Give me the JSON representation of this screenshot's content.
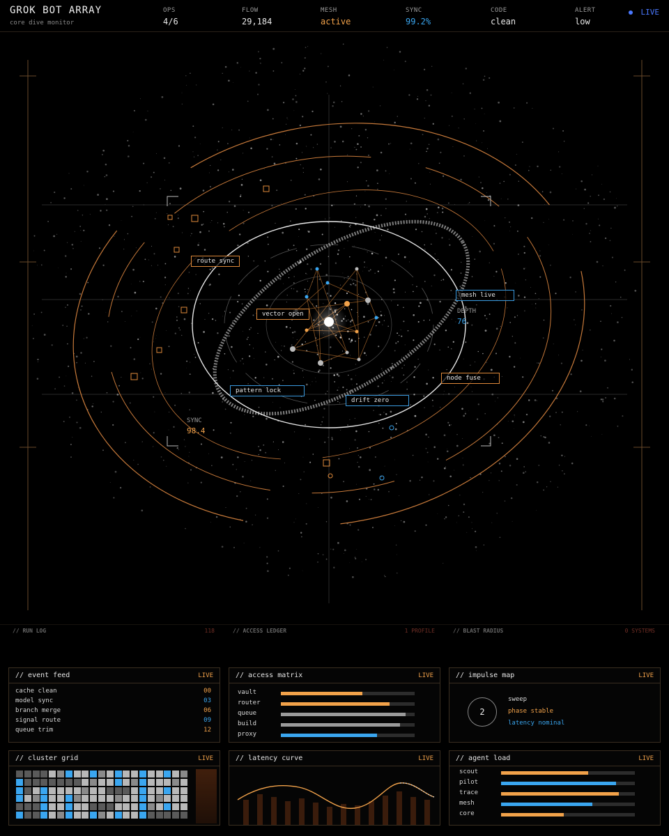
{
  "header": {
    "title": "GROK BOT ARRAY",
    "subtitle": "core dive monitor",
    "stats": [
      {
        "key": "OPS",
        "value": "4/6",
        "tone": "white"
      },
      {
        "key": "FLOW",
        "value": "29,184",
        "tone": "white"
      },
      {
        "key": "MESH",
        "value": "active",
        "tone": "orange"
      },
      {
        "key": "SYNC",
        "value": "99.2%",
        "tone": "blue"
      },
      {
        "key": "CODE",
        "value": "clean",
        "tone": "white"
      },
      {
        "key": "ALERT",
        "value": "low",
        "tone": "white"
      }
    ],
    "live": "LIVE"
  },
  "viz": {
    "tags": {
      "route_sync": "route sync",
      "vector_open": "vector open",
      "mesh_live": "mesh live",
      "node_fuse": "node fuse",
      "pattern_lock": "pattern lock",
      "drift_zero": "drift zero"
    },
    "depth": {
      "label": "DEPTH",
      "value": "76"
    },
    "sync": {
      "label": "SYNC",
      "value": "98.4"
    }
  },
  "ghost": {
    "run_log": {
      "title": "// RUN LOG",
      "count": "118"
    },
    "access_ledger": {
      "title": "// ACCESS LEDGER",
      "count": "1 PROFILE"
    },
    "blast_radius": {
      "title": "// BLAST RADIUS",
      "count": "0 SYSTEMS"
    }
  },
  "panels": {
    "event_feed": {
      "title": "// event feed",
      "live": "LIVE",
      "rows": [
        {
          "label": "cache clean",
          "value": "00",
          "tone": "o"
        },
        {
          "label": "model sync",
          "value": "03",
          "tone": "b"
        },
        {
          "label": "branch merge",
          "value": "06",
          "tone": "o"
        },
        {
          "label": "signal route",
          "value": "09",
          "tone": "b"
        },
        {
          "label": "queue trim",
          "value": "12",
          "tone": "o"
        }
      ]
    },
    "access_matrix": {
      "title": "// access matrix",
      "live": "LIVE",
      "rows": [
        {
          "label": "vault",
          "level": 0.61,
          "color": "#f2a24a"
        },
        {
          "label": "router",
          "level": 0.81,
          "color": "#f2a24a"
        },
        {
          "label": "queue",
          "level": 0.93,
          "color": "#9a9a9a"
        },
        {
          "label": "build",
          "level": 0.89,
          "color": "#9a9a9a"
        },
        {
          "label": "proxy",
          "level": 0.72,
          "color": "#3aa6f0"
        }
      ]
    },
    "impulse_map": {
      "title": "// impulse map",
      "live": "LIVE",
      "count": "2",
      "lines": [
        {
          "text": "sweep",
          "color": "#d8d8d8"
        },
        {
          "text": "phase stable",
          "color": "#f2a24a"
        },
        {
          "text": "latency nominal",
          "color": "#3aa6f0"
        }
      ]
    },
    "cluster_grid": {
      "title": "// cluster grid",
      "live": "LIVE",
      "cols": 21,
      "rows": 6,
      "blue_cells": [
        [
          4,
          9
        ],
        [
          9,
          8
        ],
        [
          12,
          17
        ],
        [
          16,
          22
        ],
        [
          30,
          29
        ],
        [
          33,
          35
        ],
        [
          34,
          37
        ],
        [
          41,
          44
        ],
        [
          45,
          47
        ],
        [
          56,
          61
        ],
        [
          62,
          65
        ],
        [
          66,
          70
        ],
        [
          77,
          78
        ],
        [
          86,
          88
        ],
        [
          90,
          92
        ],
        [
          99,
          103
        ],
        [
          104,
          110
        ],
        [
          111,
          119
        ],
        [
          120,
          122
        ]
      ],
      "dark_cells": [
        [
          0,
          3
        ],
        [
          21,
          25
        ],
        [
          26,
          28
        ],
        [
          42,
          43
        ],
        [
          53,
          55
        ],
        [
          63,
          63
        ],
        [
          84,
          86
        ],
        [
          93,
          95
        ],
        [
          105,
          107
        ],
        [
          121,
          123
        ],
        [
          124,
          125
        ]
      ]
    },
    "latency_curve": {
      "title": "// latency curve",
      "live": "LIVE"
    },
    "agent_load": {
      "title": "// agent load",
      "live": "LIVE",
      "rows": [
        {
          "label": "scout",
          "level": 0.65,
          "color": "#f2a24a"
        },
        {
          "label": "pilot",
          "level": 0.86,
          "color": "#3aa6f0"
        },
        {
          "label": "trace",
          "level": 0.88,
          "color": "#f2a24a"
        },
        {
          "label": "mesh",
          "level": 0.68,
          "color": "#3aa6f0"
        },
        {
          "label": "core",
          "level": 0.47,
          "color": "#f2a24a"
        }
      ]
    }
  }
}
